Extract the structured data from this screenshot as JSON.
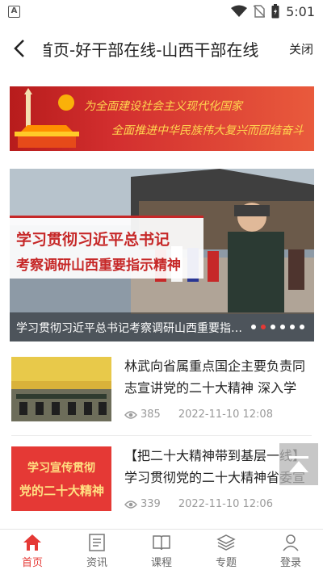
{
  "status_bar": {
    "time": "5:01"
  },
  "header": {
    "title": "首页-好干部在线-山西干部在线",
    "close_label": "关闭"
  },
  "banner": {
    "slogan_line1": "为全面建设社会主义现代化国家",
    "slogan_line2": "全面推进中华民族伟大复兴而团结奋斗"
  },
  "carousel": {
    "headline_line1": "学习贯彻习近平总书记",
    "headline_line2": "考察调研山西重要指示精神",
    "caption": "学习贯彻习近平总书记考察调研山西重要指示精神",
    "slide_count": 6,
    "active_index": 1
  },
  "news": [
    {
      "title": "林武向省属重点国企主要负责同志宣讲党的二十大精神 深入学",
      "views": "385",
      "date": "2022-11-10 12:08"
    },
    {
      "title": "【把二十大精神带到基层一线】学习贯彻党的二十大精神省委宣",
      "thumb_text_line1": "学习宣传贯彻",
      "thumb_text_line2": "党的二十大精神",
      "views": "339",
      "date": "2022-11-10 12:06"
    }
  ],
  "tabs": [
    {
      "label": "首页",
      "icon": "home-icon",
      "active": true
    },
    {
      "label": "资讯",
      "icon": "news-icon",
      "active": false
    },
    {
      "label": "课程",
      "icon": "book-icon",
      "active": false
    },
    {
      "label": "专题",
      "icon": "layers-icon",
      "active": false
    },
    {
      "label": "登录",
      "icon": "user-icon",
      "active": false
    }
  ],
  "colors": {
    "accent": "#e53935",
    "brand_red": "#c62828"
  }
}
